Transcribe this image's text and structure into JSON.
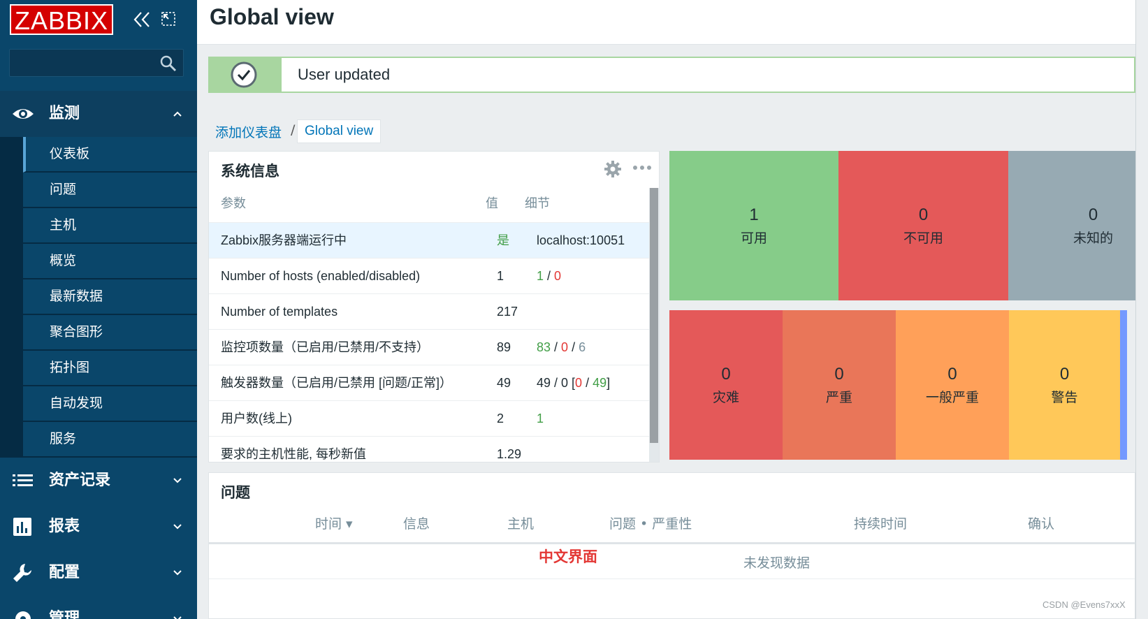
{
  "brand": {
    "logo": "ZABBIX",
    "logo_color": "#d40000",
    "sidebar_color": "#0a466a"
  },
  "header": {
    "title": "Global view"
  },
  "sidebar": {
    "sections": [
      {
        "label": "监测",
        "icon": "eye-icon",
        "expanded": true
      },
      {
        "label": "资产记录",
        "icon": "list-icon",
        "expanded": false
      },
      {
        "label": "报表",
        "icon": "bar-chart-icon",
        "expanded": false
      },
      {
        "label": "配置",
        "icon": "wrench-icon",
        "expanded": false
      },
      {
        "label": "管理",
        "icon": "gear-icon",
        "expanded": false
      }
    ],
    "monitoring_items": [
      "仪表板",
      "问题",
      "主机",
      "概览",
      "最新数据",
      "聚合图形",
      "拓扑图",
      "自动发现",
      "服务"
    ],
    "selected_item": "仪表板"
  },
  "message": {
    "text": "User updated",
    "type": "success"
  },
  "breadcrumbs": {
    "parent": "添加仪表盘",
    "separator": "/",
    "current": "Global view"
  },
  "sysinfo": {
    "title": "系统信息",
    "columns": {
      "param": "参数",
      "value": "值",
      "detail": "细节"
    },
    "rows": [
      {
        "param": "Zabbix服务器端运行中",
        "value": "是",
        "detail": "localhost:10051"
      },
      {
        "param": "Number of hosts (enabled/disabled)",
        "value": "1",
        "detail_a": "1",
        "detail_sep": " / ",
        "detail_b": "0"
      },
      {
        "param": "Number of templates",
        "value": "217",
        "detail": ""
      },
      {
        "param": "监控项数量（已启用/已禁用/不支持）",
        "value": "89",
        "detail_a": "83",
        "detail_b": "0",
        "detail_c": "6"
      },
      {
        "param": "触发器数量（已启用/已禁用 [问题/正常]）",
        "value": "49",
        "detail_prefix": "49 / 0 [",
        "detail_a": "0",
        "detail_b": "49",
        "detail_suffix": "]"
      },
      {
        "param": "用户数(线上)",
        "value": "2",
        "detail": "1"
      },
      {
        "param": "要求的主机性能, 每秒新值",
        "value": "1.29",
        "detail": ""
      }
    ]
  },
  "host_availability": [
    {
      "count": "1",
      "label": "可用",
      "color": "#86cc89"
    },
    {
      "count": "0",
      "label": "不可用",
      "color": "#e45959"
    },
    {
      "count": "0",
      "label": "未知的",
      "color": "#97aab3"
    }
  ],
  "severity": [
    {
      "count": "0",
      "label": "灾难",
      "color": "#e45959"
    },
    {
      "count": "0",
      "label": "严重",
      "color": "#e97659"
    },
    {
      "count": "0",
      "label": "一般严重",
      "color": "#ffa059"
    },
    {
      "count": "0",
      "label": "警告",
      "color": "#ffc859"
    }
  ],
  "problems": {
    "title": "问题",
    "columns": [
      "时间 ▾",
      "信息",
      "主机",
      "问题 • 严重性",
      "持续时间",
      "确认"
    ],
    "empty_text": "未发现数据",
    "annotation": "中文界面"
  },
  "watermark": "CSDN @Evens7xxX"
}
